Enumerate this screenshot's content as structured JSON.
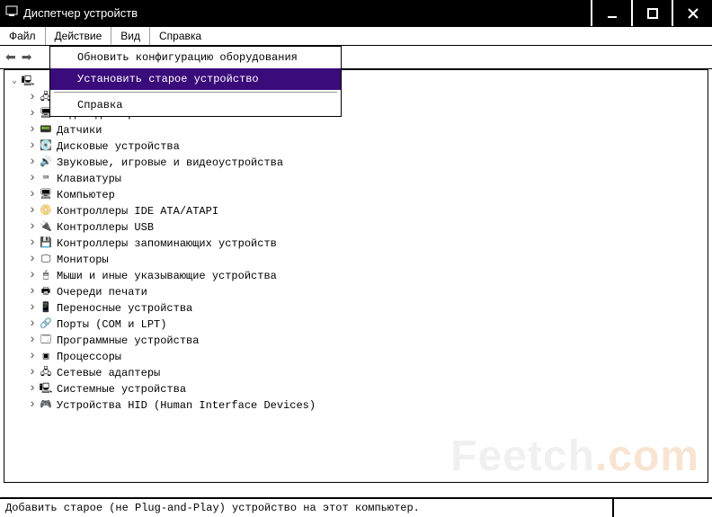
{
  "title": "Диспетчер устройств",
  "menubar": {
    "file": "Файл",
    "action": "Действие",
    "view": "Вид",
    "help": "Справка"
  },
  "dropdown": {
    "refresh": "Обновить конфигурацию оборудования",
    "install_legacy": "Установить старое устройство",
    "help": "Справка"
  },
  "tree": {
    "root": "",
    "items": [
      {
        "label": ""
      },
      {
        "label": "Видеоадаптеры"
      },
      {
        "label": "Датчики"
      },
      {
        "label": "Дисковые устройства"
      },
      {
        "label": "Звуковые, игровые и видеоустройства"
      },
      {
        "label": "Клавиатуры"
      },
      {
        "label": "Компьютер"
      },
      {
        "label": "Контроллеры IDE ATA/ATAPI"
      },
      {
        "label": "Контроллеры USB"
      },
      {
        "label": "Контроллеры запоминающих устройств"
      },
      {
        "label": "Мониторы"
      },
      {
        "label": "Мыши и иные указывающие устройства"
      },
      {
        "label": "Очереди печати"
      },
      {
        "label": "Переносные устройства"
      },
      {
        "label": "Порты (COM и LPT)"
      },
      {
        "label": "Программные устройства"
      },
      {
        "label": "Процессоры"
      },
      {
        "label": "Сетевые адаптеры"
      },
      {
        "label": "Системные устройства"
      },
      {
        "label": "Устройства HID (Human Interface Devices)"
      }
    ]
  },
  "statusbar": "Добавить старое (не Plug-and-Play) устройство на этот компьютер.",
  "watermark_a": "Feetch",
  "watermark_b": ".com"
}
